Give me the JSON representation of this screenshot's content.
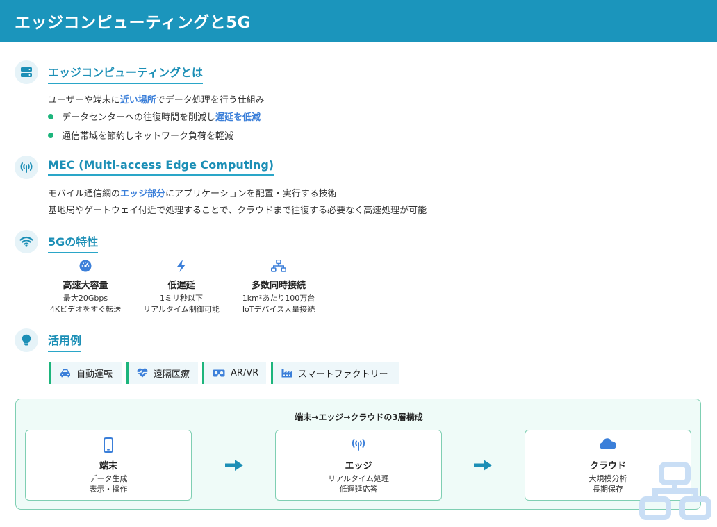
{
  "header": {
    "title": "エッジコンピューティングと5G"
  },
  "sections": {
    "edge": {
      "title": "エッジコンピューティングとは",
      "intro_pre": "ユーザーや端末に",
      "intro_hl": "近い場所",
      "intro_post": "でデータ処理を行う仕組み",
      "bullet1_pre": "データセンターへの往復時間を削減し",
      "bullet1_hl": "遅延を低減",
      "bullet2": "通信帯域を節約しネットワーク負荷を軽減"
    },
    "mec": {
      "title": "MEC (Multi-access Edge Computing)",
      "line1_pre": "モバイル通信網の",
      "line1_hl": "エッジ部分",
      "line1_post": "にアプリケーションを配置・実行する技術",
      "line2": "基地局やゲートウェイ付近で処理することで、クラウドまで往復する必要なく高速処理が可能"
    },
    "fiveg": {
      "title": "5Gの特性",
      "features": [
        {
          "icon": "speedometer-icon",
          "title": "高速大容量",
          "line1": "最大20Gbps",
          "line2": "4Kビデオをすぐ転送"
        },
        {
          "icon": "bolt-icon",
          "title": "低遅延",
          "line1": "1ミリ秒以下",
          "line2": "リアルタイム制御可能"
        },
        {
          "icon": "network-icon",
          "title": "多数同時接続",
          "line1": "1km²あたり100万台",
          "line2": "IoTデバイス大量接続"
        }
      ]
    },
    "usecases": {
      "title": "活用例",
      "tags": [
        {
          "icon": "car-icon",
          "label": "自動運転"
        },
        {
          "icon": "heartbeat-icon",
          "label": "遠隔医療"
        },
        {
          "icon": "vr-goggles-icon",
          "label": "AR/VR"
        },
        {
          "icon": "industry-icon",
          "label": "スマートファクトリー"
        }
      ]
    }
  },
  "architecture": {
    "title": "端末→エッジ→クラウドの3層構成",
    "nodes": [
      {
        "icon": "mobile-icon",
        "title": "端末",
        "line1": "データ生成",
        "line2": "表示・操作"
      },
      {
        "icon": "antenna-icon",
        "title": "エッジ",
        "line1": "リアルタイム処理",
        "line2": "低遅延応答"
      },
      {
        "icon": "cloud-icon",
        "title": "クラウド",
        "line1": "大規模分析",
        "line2": "長期保存"
      }
    ]
  },
  "colors": {
    "header": "#1b95bc",
    "accent": "#1c8fb6",
    "highlight": "#3b7fd9",
    "bullet": "#1db57c",
    "icon": "#3b7fd9"
  }
}
